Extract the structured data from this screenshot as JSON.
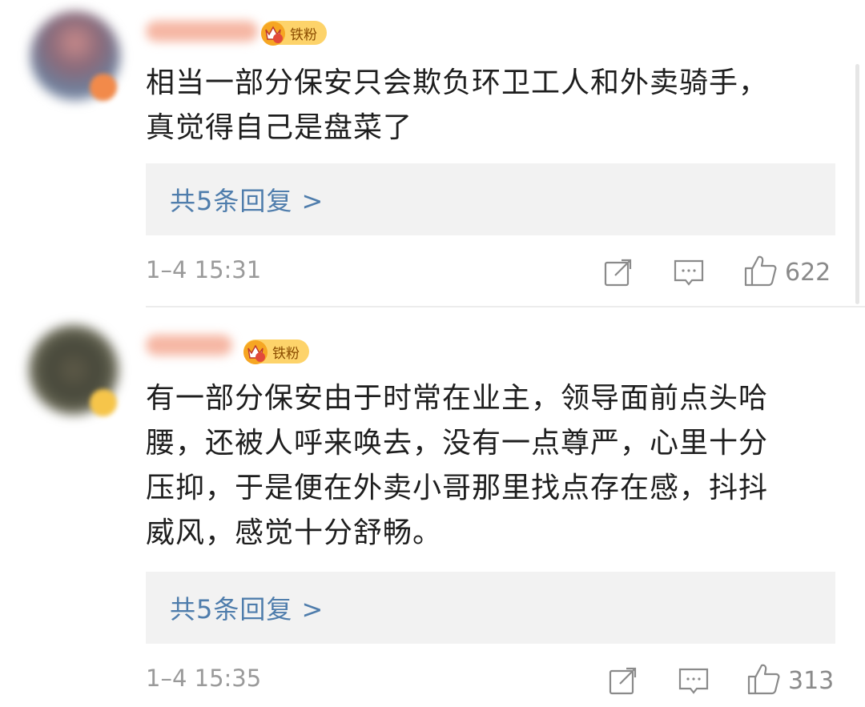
{
  "comments": [
    {
      "fan_label": "铁粉",
      "text": "相当一部分保安只会欺负环卫工人和外卖骑手，\n真觉得自己是盘菜了",
      "reply_link": "共5条回复 >",
      "time": "1–4 15:31",
      "likes": "622"
    },
    {
      "fan_label": "铁粉",
      "text": "有一部分保安由于时常在业主，领导面前点头哈\n腰，还被人呼来唤去，没有一点尊严，心里十分\n压抑，于是便在外卖小哥那里找点存在感，抖抖\n威风，感觉十分舒畅。",
      "reply_link": "共5条回复 >",
      "time": "1–4 15:35",
      "likes": "313"
    }
  ],
  "icons": {
    "share": "share-icon",
    "comment": "comment-icon",
    "like": "thumbs-up-icon",
    "crown": "crown-icon"
  },
  "colors": {
    "link": "#4f7dac",
    "fan_badge": "#fdd36a",
    "meta": "#9a9a9a"
  }
}
